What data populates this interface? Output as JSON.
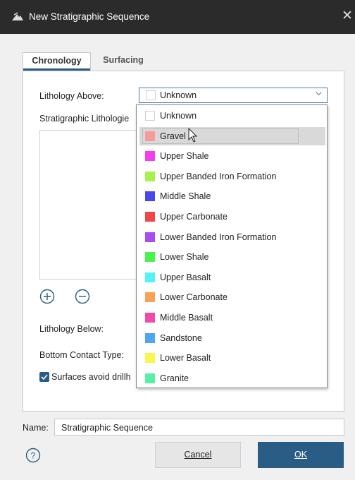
{
  "window": {
    "title": "New Stratigraphic Sequence",
    "close_glyph": "✕"
  },
  "tabs": [
    {
      "label": "Chronology",
      "active": true
    },
    {
      "label": "Surfacing",
      "active": false
    }
  ],
  "form": {
    "lithology_above_label": "Lithology Above:",
    "lithology_above_value": "Unknown",
    "strat_lithologies_label": "Stratigraphic Lithologie",
    "lithology_below_label": "Lithology Below:",
    "bottom_contact_type_label": "Bottom Contact Type:",
    "surfaces_checkbox_label": "Surfaces avoid drillh",
    "surfaces_checkbox_checked": true
  },
  "dropdown": {
    "hovered_index": 1,
    "items": [
      {
        "label": "Unknown",
        "color": "#ffffff"
      },
      {
        "label": "Gravel",
        "color": "#f79a9a"
      },
      {
        "label": "Upper Shale",
        "color": "#f43ded"
      },
      {
        "label": "Upper Banded Iron Formation",
        "color": "#a7f14d"
      },
      {
        "label": "Middle Shale",
        "color": "#4747ee"
      },
      {
        "label": "Upper Carbonate",
        "color": "#f24646"
      },
      {
        "label": "Lower Banded Iron Formation",
        "color": "#a84ef0"
      },
      {
        "label": "Lower Shale",
        "color": "#4cf24c"
      },
      {
        "label": "Upper Basalt",
        "color": "#51f3f8"
      },
      {
        "label": "Lower Carbonate",
        "color": "#f7a256"
      },
      {
        "label": "Middle Basalt",
        "color": "#f24aa8"
      },
      {
        "label": "Sandstone",
        "color": "#4ea6f1"
      },
      {
        "label": "Lower Basalt",
        "color": "#f7f74c"
      },
      {
        "label": "Granite",
        "color": "#55f0a6"
      }
    ]
  },
  "footer": {
    "name_label": "Name:",
    "name_value": "Stratigraphic Sequence",
    "cancel_label": "Cancel",
    "ok_label": "OK"
  },
  "colors": {
    "accent": "#2a5d86",
    "titlebar": "#2b2b2b"
  }
}
